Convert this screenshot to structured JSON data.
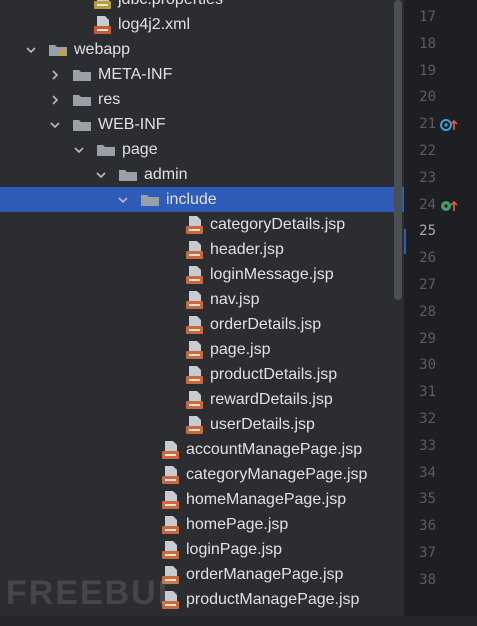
{
  "colors": {
    "background": "#2b2d30",
    "selection": "#2e5cb8",
    "gutter": "#1e1f22",
    "jsp_badge": "#c86a3c",
    "folder": "#9aa0a8"
  },
  "tree": [
    {
      "label": "jdbc.properties",
      "icon": "properties-file-icon",
      "indent": 94,
      "toggle": "none"
    },
    {
      "label": "log4j2.xml",
      "icon": "xml-file-icon",
      "indent": 94,
      "toggle": "none"
    },
    {
      "label": "webapp",
      "icon": "web-folder-icon",
      "indent": 48,
      "toggle": "expanded"
    },
    {
      "label": "META-INF",
      "icon": "folder-icon",
      "indent": 72,
      "toggle": "collapsed"
    },
    {
      "label": "res",
      "icon": "folder-icon",
      "indent": 72,
      "toggle": "collapsed"
    },
    {
      "label": "WEB-INF",
      "icon": "folder-icon",
      "indent": 72,
      "toggle": "expanded"
    },
    {
      "label": "page",
      "icon": "folder-icon",
      "indent": 96,
      "toggle": "expanded"
    },
    {
      "label": "admin",
      "icon": "folder-icon",
      "indent": 118,
      "toggle": "expanded"
    },
    {
      "label": "include",
      "icon": "folder-icon",
      "indent": 140,
      "toggle": "expanded",
      "selected": true
    },
    {
      "label": "categoryDetails.jsp",
      "icon": "jsp-file-icon",
      "indent": 186,
      "toggle": "none"
    },
    {
      "label": "header.jsp",
      "icon": "jsp-file-icon",
      "indent": 186,
      "toggle": "none"
    },
    {
      "label": "loginMessage.jsp",
      "icon": "jsp-file-icon",
      "indent": 186,
      "toggle": "none"
    },
    {
      "label": "nav.jsp",
      "icon": "jsp-file-icon",
      "indent": 186,
      "toggle": "none"
    },
    {
      "label": "orderDetails.jsp",
      "icon": "jsp-file-icon",
      "indent": 186,
      "toggle": "none"
    },
    {
      "label": "page.jsp",
      "icon": "jsp-file-icon",
      "indent": 186,
      "toggle": "none"
    },
    {
      "label": "productDetails.jsp",
      "icon": "jsp-file-icon",
      "indent": 186,
      "toggle": "none"
    },
    {
      "label": "rewardDetails.jsp",
      "icon": "jsp-file-icon",
      "indent": 186,
      "toggle": "none"
    },
    {
      "label": "userDetails.jsp",
      "icon": "jsp-file-icon",
      "indent": 186,
      "toggle": "none"
    },
    {
      "label": "accountManagePage.jsp",
      "icon": "jsp-file-icon",
      "indent": 162,
      "toggle": "none"
    },
    {
      "label": "categoryManagePage.jsp",
      "icon": "jsp-file-icon",
      "indent": 162,
      "toggle": "none"
    },
    {
      "label": "homeManagePage.jsp",
      "icon": "jsp-file-icon",
      "indent": 162,
      "toggle": "none"
    },
    {
      "label": "homePage.jsp",
      "icon": "jsp-file-icon",
      "indent": 162,
      "toggle": "none"
    },
    {
      "label": "loginPage.jsp",
      "icon": "jsp-file-icon",
      "indent": 162,
      "toggle": "none"
    },
    {
      "label": "orderManagePage.jsp",
      "icon": "jsp-file-icon",
      "indent": 162,
      "toggle": "none"
    },
    {
      "label": "productManagePage.jsp",
      "icon": "jsp-file-icon",
      "indent": 162,
      "toggle": "none"
    }
  ],
  "gutter": {
    "line_numbers": [
      "17",
      "18",
      "19",
      "20",
      "21",
      "22",
      "23",
      "24",
      "25",
      "26",
      "27",
      "28",
      "29",
      "30",
      "31",
      "32",
      "33",
      "34",
      "35",
      "36",
      "37",
      "38"
    ],
    "current_line": "25",
    "marker_lines": [
      "21",
      "24"
    ]
  },
  "watermark": "FREEBUF"
}
